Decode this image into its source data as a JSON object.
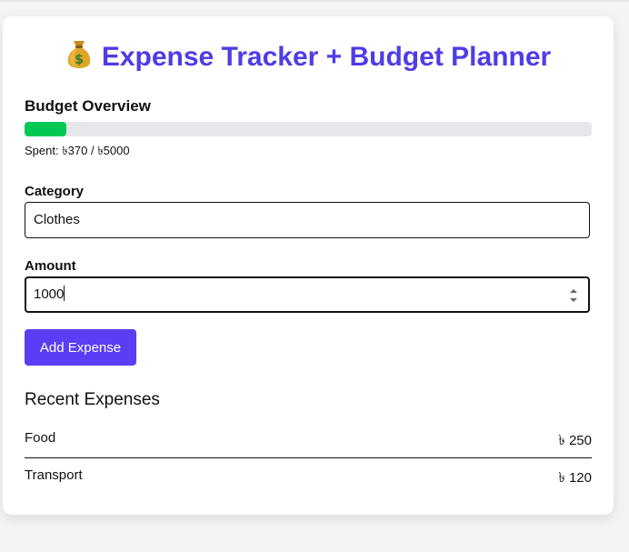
{
  "app": {
    "title": "Expense Tracker + Budget Planner",
    "title_icon": "money-bag-icon"
  },
  "budget": {
    "heading": "Budget Overview",
    "spent_text": "Spent: ৳370 / ৳5000",
    "spent": 370,
    "total": 5000,
    "progress_fraction": 0.074,
    "progress_color": "#00c853"
  },
  "form": {
    "category_label": "Category",
    "category_value": "Clothes",
    "amount_label": "Amount",
    "amount_value": "1000",
    "add_button_label": "Add Expense"
  },
  "recent": {
    "heading": "Recent Expenses",
    "items": [
      {
        "name": "Food",
        "amount": "৳ 250"
      },
      {
        "name": "Transport",
        "amount": "৳ 120"
      }
    ]
  },
  "colors": {
    "accent": "#4f3ce6",
    "button": "#5b3df5",
    "progress": "#00c853"
  }
}
